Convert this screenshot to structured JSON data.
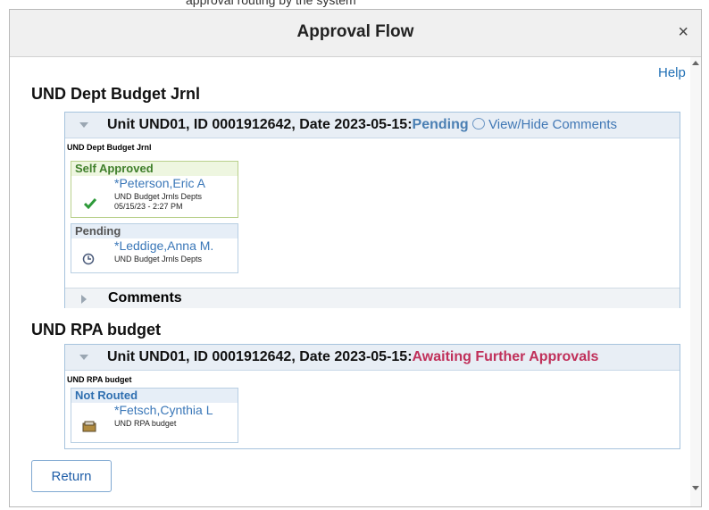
{
  "top_hint": "approval routing by the system",
  "modal": {
    "title": "Approval Flow",
    "close_icon": "×",
    "help_label": "Help",
    "return_label": "Return"
  },
  "stages": [
    {
      "title": "UND Dept Budget Jrnl",
      "header_prefix": "Unit UND01, ID 0001912642, Date 2023-05-15:",
      "status": "Pending",
      "view_hide": "View/Hide Comments",
      "path_label": "UND Dept Budget Jrnl",
      "steps": [
        {
          "state": "Self Approved",
          "name": "*Peterson,Eric A",
          "role": "UND Budget Jrnls Depts",
          "date": "05/15/23 - 2:27 PM",
          "icon": "check-icon"
        },
        {
          "state": "Pending",
          "name": "*Leddige,Anna M.",
          "role": "UND Budget Jrnls Depts",
          "icon": "clock-icon"
        }
      ],
      "comments_label": "Comments"
    },
    {
      "title": "UND RPA budget",
      "header_prefix": "Unit UND01, ID 0001912642, Date 2023-05-15:",
      "status": "Awaiting Further Approvals",
      "path_label": "UND RPA budget",
      "steps": [
        {
          "state": "Not Routed",
          "name": "*Fetsch,Cynthia L",
          "role": "UND RPA budget",
          "icon": "inbox-icon"
        }
      ]
    }
  ],
  "colors": {
    "approved_border": "#b9d08c",
    "approved_header": "#eef6e0",
    "pending_border": "#b8cfe3",
    "pending_header": "#e6eef7",
    "link": "#3a77b8",
    "await_status": "#c0305a"
  }
}
